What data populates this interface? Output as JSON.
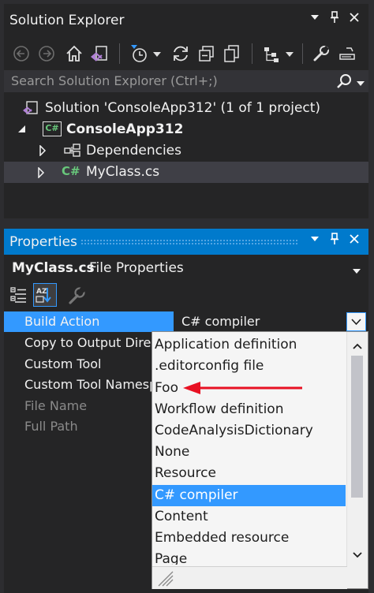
{
  "solution_explorer": {
    "title": "Solution Explorer",
    "search_placeholder": "Search Solution Explorer (Ctrl+;)",
    "tree": [
      {
        "label": "Solution 'ConsoleApp312' (1 of 1 project)",
        "icon": "solution-icon"
      },
      {
        "label": "ConsoleApp312",
        "icon": "csharp-project-icon",
        "bold": true
      },
      {
        "label": "Dependencies",
        "icon": "dependencies-icon"
      },
      {
        "label": "MyClass.cs",
        "icon": "csharp-file-icon",
        "file_icon_text": "C#",
        "selected": true
      }
    ],
    "project_icon_text": "C#"
  },
  "properties": {
    "title": "Properties",
    "object_name": "MyClass.cs",
    "object_type": "File Properties",
    "rows": [
      {
        "label": "Build Action",
        "value": "C# compiler",
        "selected": true
      },
      {
        "label": "Copy to Output Directory"
      },
      {
        "label": "Custom Tool"
      },
      {
        "label": "Custom Tool Namespace"
      },
      {
        "label": "File Name",
        "disabled": true
      },
      {
        "label": "Full Path",
        "disabled": true
      }
    ],
    "dropdown_options": [
      "Application definition",
      ".editorconfig file",
      "Foo",
      "Workflow definition",
      "CodeAnalysisDictionary",
      "None",
      "Resource",
      "C# compiler",
      "Content",
      "Embedded resource",
      "Page"
    ],
    "selected_option": "C# compiler"
  },
  "colors": {
    "accent": "#007acc",
    "selection": "#3399ff",
    "arrow": "#e81123",
    "csharp_green": "#68c77b",
    "vs_purple": "#b180d7"
  }
}
